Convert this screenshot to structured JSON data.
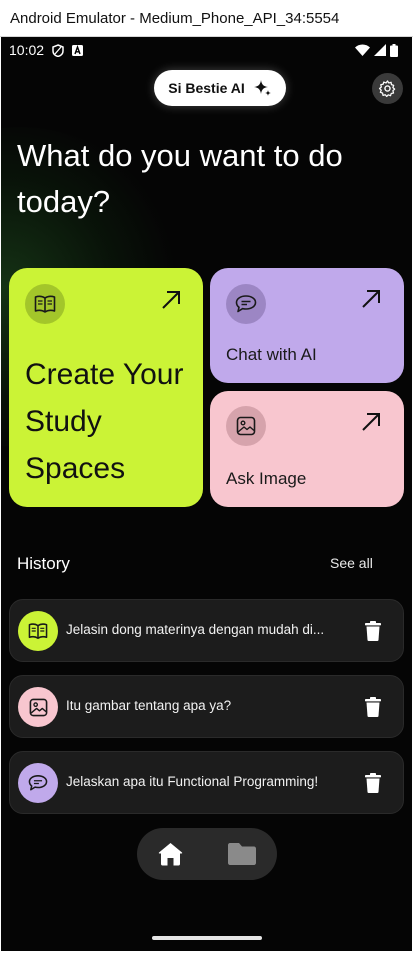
{
  "window": {
    "title": "Android Emulator - Medium_Phone_API_34:5554"
  },
  "status_bar": {
    "time": "10:02"
  },
  "header": {
    "brand": "Si Bestie AI"
  },
  "headline": "What do you want to do today?",
  "cards": {
    "study": {
      "title": "Create Your Study Spaces",
      "color": "#cbf336"
    },
    "chat": {
      "title": "Chat with AI",
      "color": "#c0a9eb"
    },
    "image": {
      "title": "Ask Image",
      "color": "#f8c6cf"
    }
  },
  "history": {
    "title": "History",
    "see_all": "See all",
    "items": [
      {
        "text": "Jelasin dong materinya dengan mudah di...",
        "icon": "book-icon",
        "color": "#cbf336"
      },
      {
        "text": "Itu gambar tentang apa ya?",
        "icon": "image-icon",
        "color": "#f8c6cf"
      },
      {
        "text": "Jelaskan apa itu Functional Programming!",
        "icon": "chat-icon",
        "color": "#c0a9eb"
      }
    ]
  },
  "bottom_nav": {
    "items": [
      {
        "icon": "home-icon",
        "active": true
      },
      {
        "icon": "folder-icon",
        "active": false
      }
    ]
  }
}
